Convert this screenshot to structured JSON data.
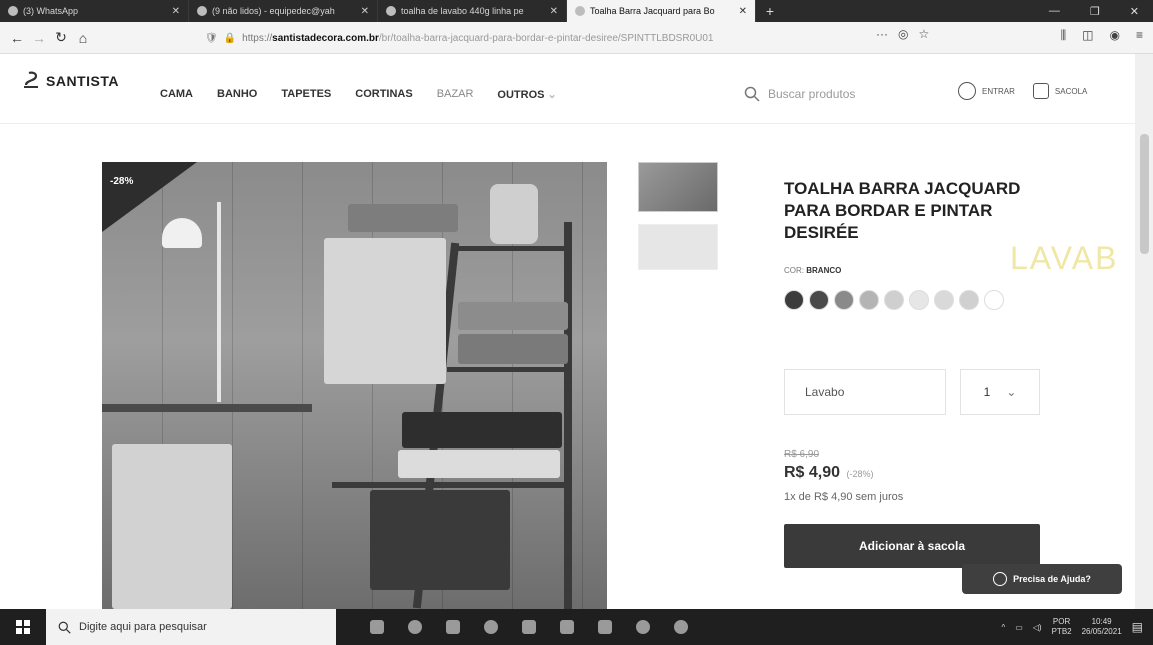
{
  "browser": {
    "tabs": [
      {
        "label": "(3) WhatsApp",
        "active": false
      },
      {
        "label": "(9 não lidos) - equipedec@yah",
        "active": false
      },
      {
        "label": "toalha de lavabo 440g linha pe",
        "active": false
      },
      {
        "label": "Toalha Barra Jacquard para Bo",
        "active": true
      }
    ],
    "new_tab": "+",
    "url_prefix": "https://",
    "url_host": "santistadecora.com.br",
    "url_path": "/br/toalha-barra-jacquard-para-bordar-e-pintar-desiree/SPINTTLBDSR0U01",
    "url_more": "···"
  },
  "site": {
    "logo": "SANTISTA",
    "menu": [
      "CAMA",
      "BANHO",
      "TAPETES",
      "CORTINAS",
      "BAZAR",
      "OUTROS"
    ],
    "search_placeholder": "Buscar produtos",
    "login_label": "ENTRAR",
    "bag_label": "SACOLA"
  },
  "product": {
    "discount_badge": "-28%",
    "title_lines": [
      "TOALHA BARRA JACQUARD",
      "PARA BORDAR E PINTAR",
      "DESIRÉE"
    ],
    "color_label": "COR:",
    "color_value": "BRANCO",
    "swatches": [
      "#3c3c3c",
      "#4a4a4a",
      "#8a8a8a",
      "#b4b4b4",
      "#cfcfcf",
      "#e6e6e6",
      "#d9d9d9",
      "#d0d0d0",
      "#ffffff"
    ],
    "size_value": "Lavabo",
    "quantity": "1",
    "old_price": "R$ 6,90",
    "new_price": "R$ 4,90",
    "discount_pct": "(-28%)",
    "installment": "1x de R$ 4,90 sem juros",
    "add_button": "Adicionar à sacola",
    "help_button": "Precisa de Ajuda?",
    "side_decoration": "LAVAB"
  },
  "taskbar": {
    "search_placeholder": "Digite aqui para pesquisar",
    "lang": "POR",
    "lang2": "PTB2",
    "time": "10:49",
    "date": "26/05/2021"
  }
}
